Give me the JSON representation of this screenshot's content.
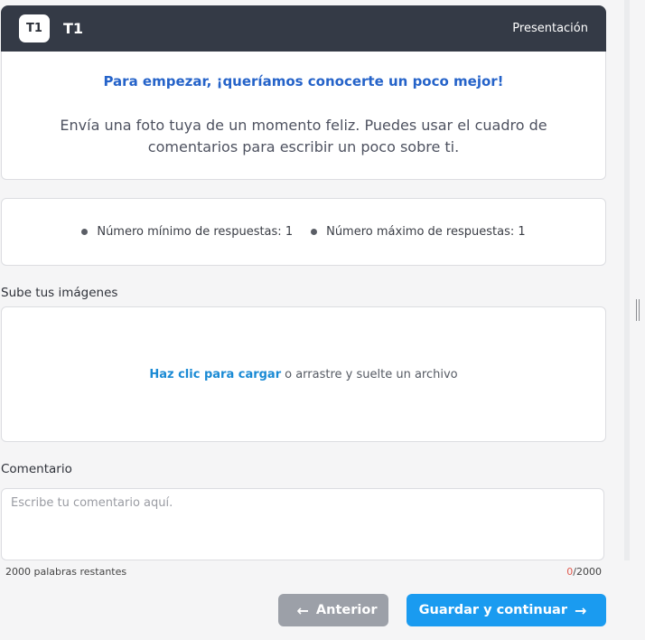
{
  "header": {
    "badge": "T1",
    "title": "T1",
    "section": "Presentación"
  },
  "intro": {
    "heading": "Para empezar, ¡queríamos conocerte un poco mejor!",
    "body": "Envía una foto tuya de un momento feliz. Puedes usar el cuadro de comentarios para escribir un poco sobre ti."
  },
  "limits": {
    "min": "Número mínimo de respuestas: 1",
    "max": "Número máximo de respuestas: 1"
  },
  "upload": {
    "label": "Sube tus imágenes",
    "link": "Haz clic para cargar",
    "text": "o arrastre y suelte un archivo"
  },
  "comment": {
    "label": "Comentario",
    "placeholder": "Escribe tu comentario aquí.",
    "value": "",
    "words_left": "2000 palabras restantes",
    "count_current": "0",
    "count_max": "/2000"
  },
  "nav": {
    "prev_label": "Anterior",
    "next_label": "Guardar y continuar"
  },
  "icons": {
    "prev": "arrow-left-icon",
    "next": "arrow-right-icon",
    "handle": "resize-handle-icon"
  },
  "colors": {
    "header_bg": "#343a46",
    "heading_blue": "#2563c9",
    "link_blue": "#1a8ad4",
    "primary_button": "#1a9bf0",
    "secondary_button": "#9ca0a8",
    "counter_red": "#e05a4e"
  }
}
